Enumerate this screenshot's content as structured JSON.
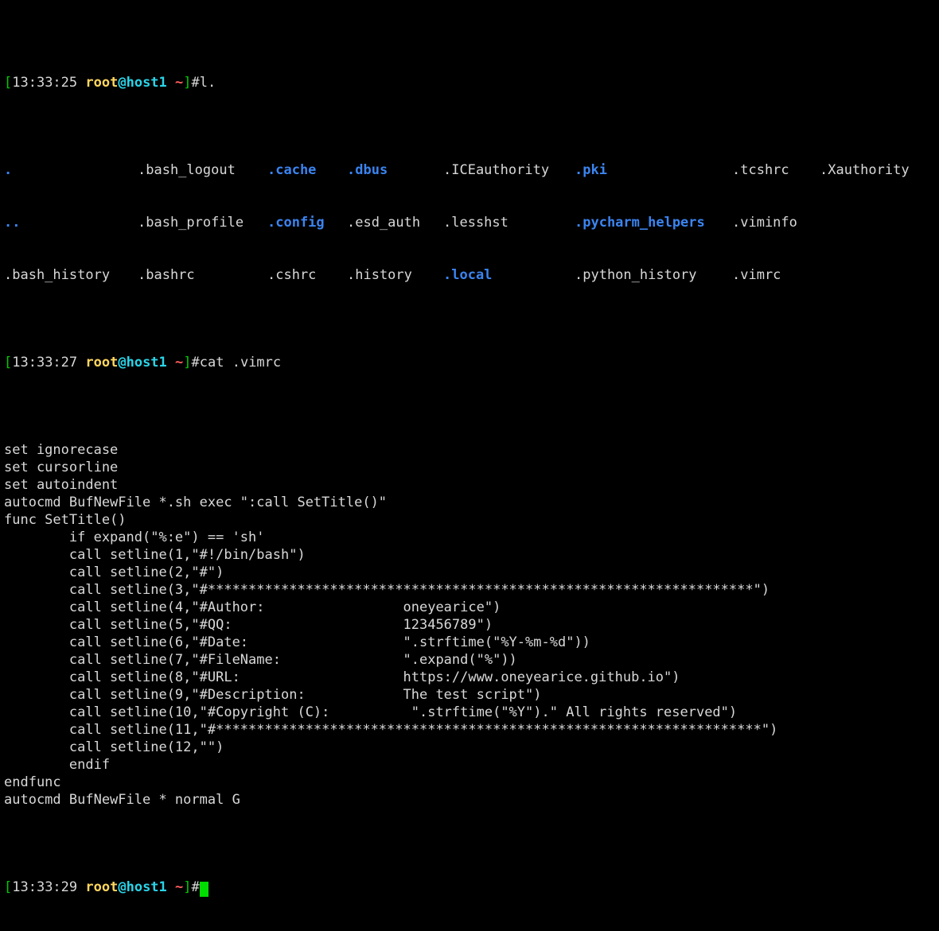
{
  "terminal": {
    "colors": {
      "background": "#000000",
      "foreground": "#d8d8d8",
      "green": "#00cc00",
      "yellow": "#ffd75f",
      "cyan": "#2ad4e8",
      "red": "#ff5f5f",
      "directory_blue": "#3b84f0",
      "cursor": "#00dd00"
    },
    "prompt1": {
      "open_bracket": "[",
      "time": "13:33:25",
      "user": "root",
      "at": "@",
      "host": "host1",
      "space": " ",
      "path": "~",
      "close_bracket": "]",
      "hash": "#",
      "command": "l."
    },
    "listing": {
      "rows": [
        [
          {
            "text": ".",
            "type": "directory"
          },
          {
            "text": ".bash_logout",
            "type": "file"
          },
          {
            "text": ".cache",
            "type": "directory"
          },
          {
            "text": ".dbus",
            "type": "directory"
          },
          {
            "text": ".ICEauthority",
            "type": "file"
          },
          {
            "text": ".pki",
            "type": "directory"
          },
          {
            "text": ".tcshrc",
            "type": "file"
          },
          {
            "text": ".Xauthority",
            "type": "file"
          }
        ],
        [
          {
            "text": "..",
            "type": "directory"
          },
          {
            "text": ".bash_profile",
            "type": "file"
          },
          {
            "text": ".config",
            "type": "directory"
          },
          {
            "text": ".esd_auth",
            "type": "file"
          },
          {
            "text": ".lesshst",
            "type": "file"
          },
          {
            "text": ".pycharm_helpers",
            "type": "directory"
          },
          {
            "text": ".viminfo",
            "type": "file"
          },
          {
            "text": "",
            "type": "file"
          }
        ],
        [
          {
            "text": ".bash_history",
            "type": "file"
          },
          {
            "text": ".bashrc",
            "type": "file"
          },
          {
            "text": ".cshrc",
            "type": "file"
          },
          {
            "text": ".history",
            "type": "file"
          },
          {
            "text": ".local",
            "type": "directory"
          },
          {
            "text": ".python_history",
            "type": "file"
          },
          {
            "text": ".vimrc",
            "type": "file"
          },
          {
            "text": "",
            "type": "file"
          }
        ]
      ]
    },
    "prompt2": {
      "open_bracket": "[",
      "time": "13:33:27",
      "user": "root",
      "at": "@",
      "host": "host1",
      "space": " ",
      "path": "~",
      "close_bracket": "]",
      "hash": "#",
      "command": "cat .vimrc"
    },
    "file_output": [
      "set ignorecase",
      "set cursorline",
      "set autoindent",
      "autocmd BufNewFile *.sh exec \":call SetTitle()\"",
      "func SetTitle()",
      "        if expand(\"%:e\") == 'sh'",
      "        call setline(1,\"#!/bin/bash\")",
      "        call setline(2,\"#\")",
      "        call setline(3,\"#*******************************************************************\")",
      "        call setline(4,\"#Author:                 oneyearice\")",
      "        call setline(5,\"#QQ:                     123456789\")",
      "        call setline(6,\"#Date:                   \".strftime(\"%Y-%m-%d\"))",
      "        call setline(7,\"#FileName:               \".expand(\"%\"))",
      "        call setline(8,\"#URL:                    https://www.oneyearice.github.io\")",
      "        call setline(9,\"#Description:            The test script\")",
      "        call setline(10,\"#Copyright (C):          \".strftime(\"%Y\").\" All rights reserved\")",
      "        call setline(11,\"#*******************************************************************\")",
      "        call setline(12,\"\")",
      "        endif",
      "endfunc",
      "autocmd BufNewFile * normal G"
    ],
    "prompt3": {
      "open_bracket": "[",
      "time": "13:33:29",
      "user": "root",
      "at": "@",
      "host": "host1",
      "space": " ",
      "path": "~",
      "close_bracket": "]",
      "hash": "#",
      "command": ""
    }
  }
}
